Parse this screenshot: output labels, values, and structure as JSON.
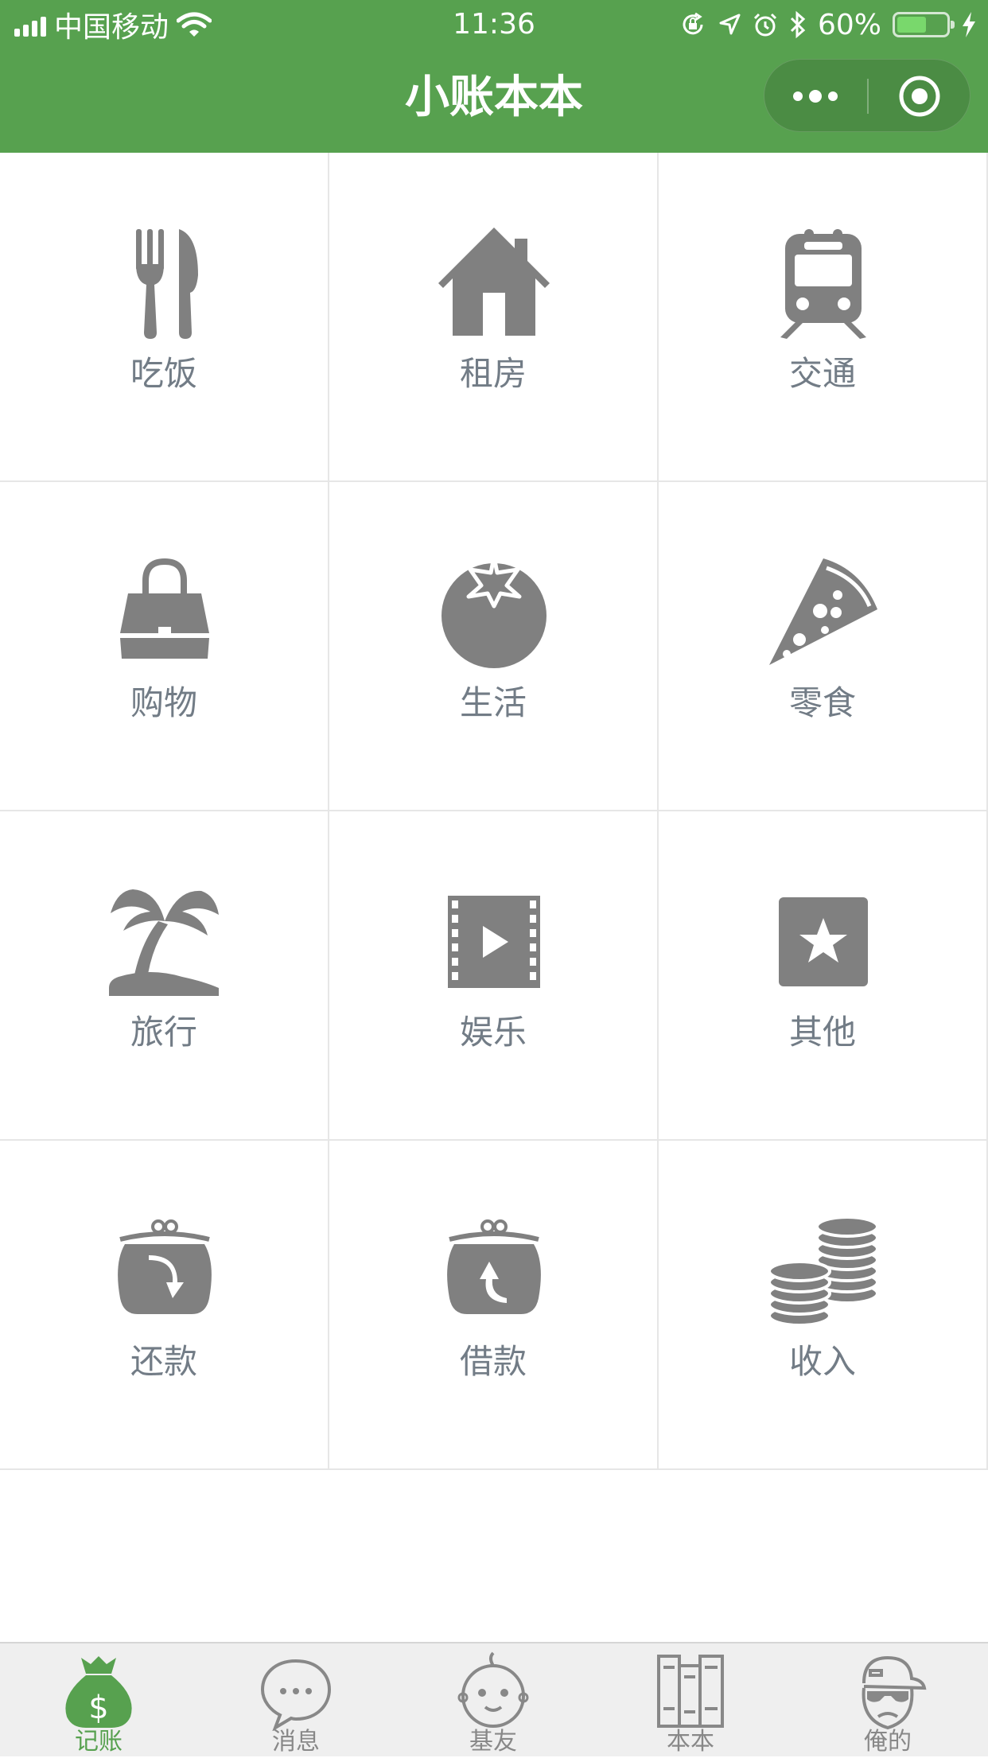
{
  "status_bar": {
    "carrier": "中国移动",
    "time": "11:36",
    "battery": "60%",
    "battery_level": 0.6
  },
  "nav": {
    "title": "小账本本"
  },
  "categories": [
    {
      "label": "吃饭",
      "icon": "fork-knife-icon"
    },
    {
      "label": "租房",
      "icon": "house-icon"
    },
    {
      "label": "交通",
      "icon": "train-icon"
    },
    {
      "label": "购物",
      "icon": "handbag-icon"
    },
    {
      "label": "生活",
      "icon": "tomato-icon"
    },
    {
      "label": "零食",
      "icon": "pizza-icon"
    },
    {
      "label": "旅行",
      "icon": "palm-tree-icon"
    },
    {
      "label": "娱乐",
      "icon": "film-icon"
    },
    {
      "label": "其他",
      "icon": "star-icon"
    },
    {
      "label": "还款",
      "icon": "purse-down-icon"
    },
    {
      "label": "借款",
      "icon": "purse-up-icon"
    },
    {
      "label": "收入",
      "icon": "coins-icon"
    }
  ],
  "tabbar": {
    "items": [
      {
        "label": "记账",
        "icon": "money-bag-icon",
        "active": true
      },
      {
        "label": "消息",
        "icon": "chat-bubble-icon",
        "active": false
      },
      {
        "label": "基友",
        "icon": "baby-face-icon",
        "active": false
      },
      {
        "label": "本本",
        "icon": "books-icon",
        "active": false
      },
      {
        "label": "俺的",
        "icon": "cap-face-icon",
        "active": false
      }
    ]
  },
  "colors": {
    "brand_green": "#57a14f",
    "icon_gray": "#808080",
    "label_gray": "#727c86",
    "tab_inactive": "#888888"
  }
}
